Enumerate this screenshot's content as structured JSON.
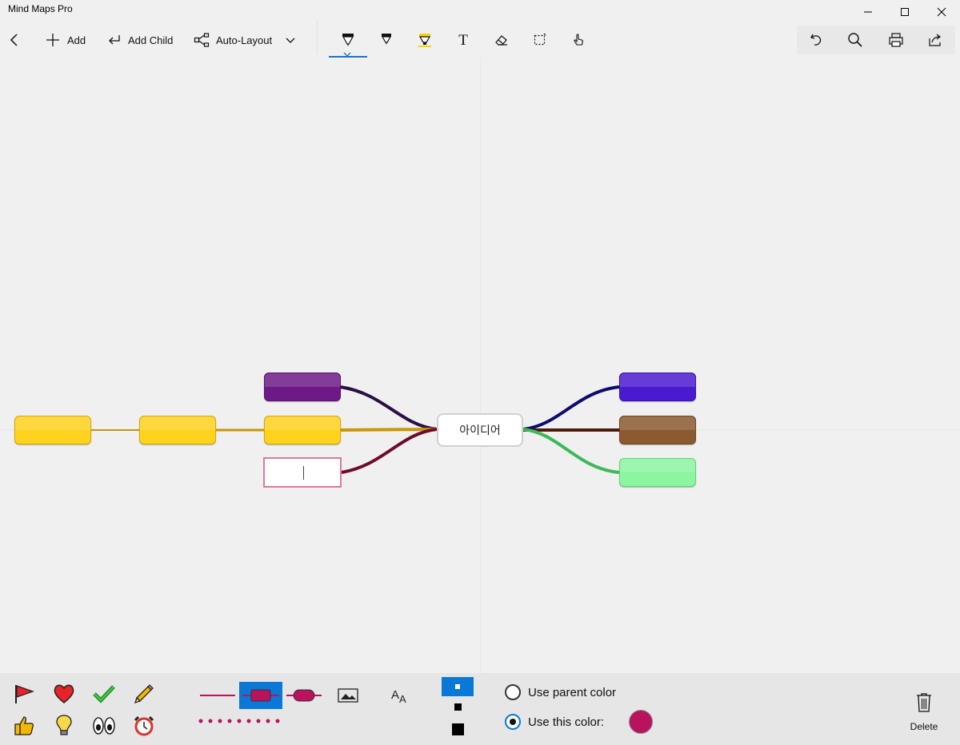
{
  "app": {
    "title": "Mind Maps Pro"
  },
  "window": {
    "minimize_icon": "minimize-icon",
    "maximize_icon": "maximize-icon",
    "close_icon": "close-icon"
  },
  "toolbar": {
    "back_icon": "back-arrow-icon",
    "add_label": "Add",
    "add_child_label": "Add Child",
    "auto_layout_label": "Auto-Layout",
    "tools": [
      "ballpoint-pen",
      "pencil",
      "highlighter",
      "text",
      "eraser",
      "lasso-select",
      "touch-writing"
    ],
    "selected_tool": "ballpoint-pen",
    "actions": [
      "undo",
      "search",
      "print",
      "share"
    ]
  },
  "map": {
    "central_text": "아이디어",
    "left_nodes": [
      {
        "color": "#6e1a86"
      },
      {
        "color": "#ffd21f"
      },
      {
        "color": "#ffffff",
        "editing": true,
        "border": "#d87aa0"
      },
      {
        "color": "#ffd21f"
      },
      {
        "color": "#ffd21f"
      }
    ],
    "right_nodes": [
      {
        "color": "#4a1ad0"
      },
      {
        "color": "#8b5a30"
      },
      {
        "color": "#8bf5a0"
      }
    ],
    "link_colors": [
      "#2a0f44",
      "#c8960a",
      "#6e0a2e",
      "#0c0c70",
      "#4a1a0a",
      "#3db85a"
    ]
  },
  "bottom_panel": {
    "stickers": [
      "flag",
      "heart",
      "check",
      "pencil",
      "thumbs-up",
      "lightbulb",
      "eyes",
      "alarm-clock"
    ],
    "line_styles": [
      "line-plain",
      "line-rect-box",
      "line-rounded-box",
      "image",
      "font",
      "dotted-line"
    ],
    "selected_line_style": "line-rect-box",
    "sizes": [
      "small",
      "medium",
      "large"
    ],
    "selected_size": "small",
    "use_parent_color_label": "Use parent color",
    "use_this_color_label": "Use this color:",
    "selected_option": "use_this_color",
    "selected_color": "#b8135c",
    "delete_label": "Delete"
  }
}
